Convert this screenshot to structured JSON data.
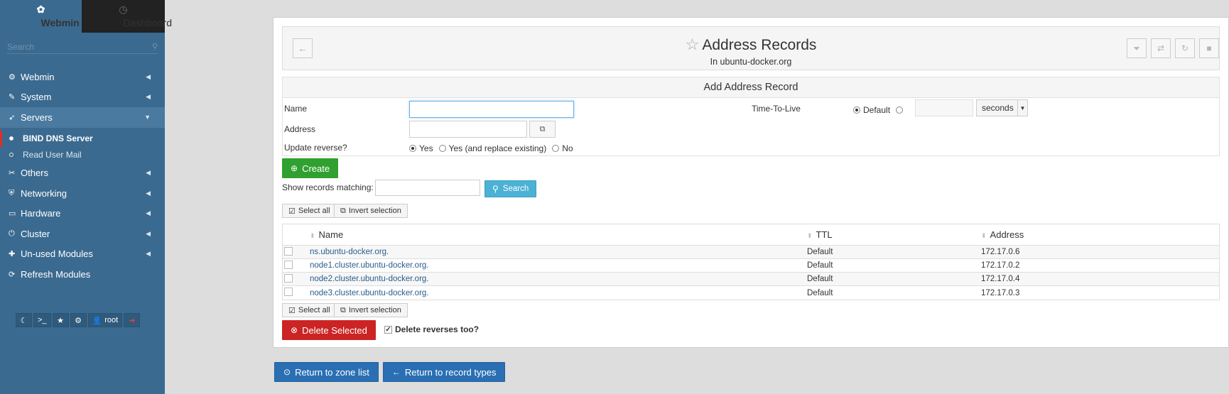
{
  "sidebar": {
    "tabs": [
      {
        "label": "Webmin",
        "icon": "webmin-logo-icon"
      },
      {
        "label": "Dashboard",
        "icon": "dashboard-icon"
      }
    ],
    "search_placeholder": "Search",
    "menu": [
      {
        "label": "Webmin",
        "icon": "gear-icon"
      },
      {
        "label": "System",
        "icon": "wrench-icon"
      },
      {
        "label": "Servers",
        "icon": "rocket-icon"
      },
      {
        "label": "Others",
        "icon": "tools-icon"
      },
      {
        "label": "Networking",
        "icon": "shield-icon"
      },
      {
        "label": "Hardware",
        "icon": "hdd-icon"
      },
      {
        "label": "Cluster",
        "icon": "power-icon"
      },
      {
        "label": "Un-used Modules",
        "icon": "puzzle-icon"
      },
      {
        "label": "Refresh Modules",
        "icon": "refresh-icon"
      }
    ],
    "submenu": [
      {
        "label": "BIND DNS Server"
      },
      {
        "label": "Read User Mail"
      }
    ],
    "user": "root"
  },
  "page": {
    "title": "Address Records",
    "subtitle": "In ubuntu-docker.org"
  },
  "form": {
    "heading": "Add Address Record",
    "name_label": "Name",
    "address_label": "Address",
    "update_reverse_label": "Update reverse?",
    "update_reverse_options": [
      "Yes",
      "Yes (and replace existing)",
      "No"
    ],
    "ttl_label": "Time-To-Live",
    "ttl_default": "Default",
    "ttl_unit": "seconds",
    "create_label": "Create"
  },
  "search": {
    "label": "Show records matching:",
    "button": "Search"
  },
  "selection": {
    "select_all": "Select all",
    "invert": "Invert selection"
  },
  "table": {
    "headers": [
      "Name",
      "TTL",
      "Address"
    ],
    "rows": [
      {
        "name": "ns.ubuntu-docker.org.",
        "ttl": "Default",
        "address": "172.17.0.6"
      },
      {
        "name": "node1.cluster.ubuntu-docker.org.",
        "ttl": "Default",
        "address": "172.17.0.2"
      },
      {
        "name": "node2.cluster.ubuntu-docker.org.",
        "ttl": "Default",
        "address": "172.17.0.4"
      },
      {
        "name": "node3.cluster.ubuntu-docker.org.",
        "ttl": "Default",
        "address": "172.17.0.3"
      }
    ]
  },
  "actions": {
    "delete_selected": "Delete Selected",
    "delete_reverses": "Delete reverses too?",
    "return_zone": "Return to zone list",
    "return_types": "Return to record types"
  }
}
